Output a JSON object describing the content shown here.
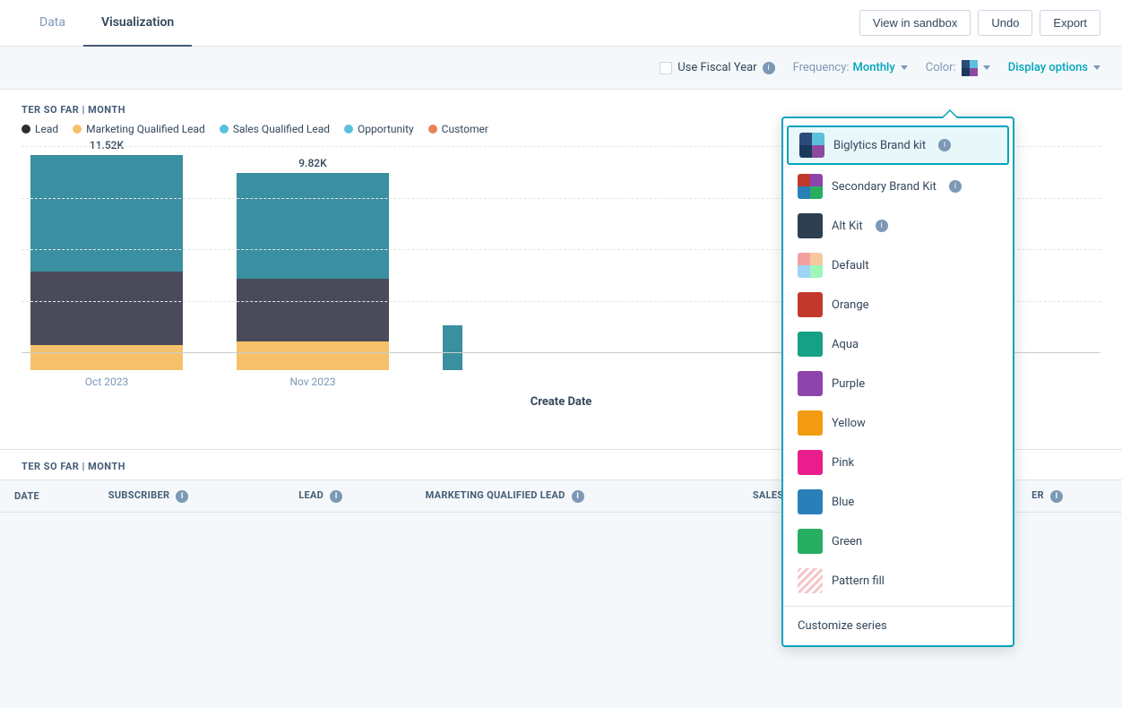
{
  "nav": {
    "tabs": [
      {
        "id": "data",
        "label": "Data",
        "active": false
      },
      {
        "id": "visualization",
        "label": "Visualization",
        "active": true
      }
    ],
    "actions": {
      "sandbox_label": "View in sandbox",
      "undo_label": "Undo",
      "export_label": "Export"
    }
  },
  "controls": {
    "fiscal_year_label": "Use Fiscal Year",
    "frequency_label": "Frequency:",
    "frequency_value": "Monthly",
    "color_label": "Color:",
    "display_options_label": "Display options"
  },
  "chart": {
    "section_label": "TER SO FAR | MONTH",
    "legend": [
      {
        "id": "lead",
        "label": "Lead",
        "color": "#000000"
      },
      {
        "id": "mql",
        "label": "Marketing Qualified Lead",
        "color": "#f5c26b"
      },
      {
        "id": "sql",
        "label": "Sales Qualified Lead",
        "color": "#f5c26b"
      },
      {
        "id": "opportunity",
        "label": "Opportunity",
        "color": "#5bc0de"
      },
      {
        "id": "customer",
        "label": "Customer",
        "color": "#e8845c"
      }
    ],
    "bars": [
      {
        "label": "Oct 2023",
        "total": "11.52K",
        "segments": [
          {
            "color": "#f5c26b",
            "height": 28
          },
          {
            "color": "#4a4a5a",
            "height": 80
          },
          {
            "color": "#3a8fa0",
            "height": 135
          }
        ]
      },
      {
        "label": "Nov 2023",
        "total": "9.82K",
        "segments": [
          {
            "color": "#f5c26b",
            "height": 32
          },
          {
            "color": "#4a4a5a",
            "height": 70
          },
          {
            "color": "#3a8fa0",
            "height": 120
          }
        ]
      }
    ],
    "x_axis_label": "Create Date"
  },
  "color_dropdown": {
    "items": [
      {
        "id": "biglytics",
        "label": "Biglytics Brand kit",
        "selected": true,
        "swatch_colors": [
          "#2d4a7a",
          "#5bc0de",
          "#1a3a5c",
          "#8b4a9e"
        ]
      },
      {
        "id": "secondary",
        "label": "Secondary Brand Kit",
        "selected": false,
        "swatch_colors": [
          "#c0392b",
          "#8e44ad",
          "#2980b9",
          "#27ae60"
        ]
      },
      {
        "id": "alt",
        "label": "Alt Kit",
        "selected": false,
        "swatch_colors": [
          "#2c3e50",
          "#2c3e50",
          "#2c3e50",
          "#2c3e50"
        ],
        "single_color": "#2c3e50"
      },
      {
        "id": "default",
        "label": "Default",
        "selected": false,
        "swatch_colors": [
          "#f5a0a0",
          "#f7c8a0",
          "#f5f0a0",
          "#a0d4f5"
        ]
      },
      {
        "id": "orange",
        "label": "Orange",
        "selected": false,
        "single_color": "#c0392b"
      },
      {
        "id": "aqua",
        "label": "Aqua",
        "selected": false,
        "single_color": "#16a085"
      },
      {
        "id": "purple",
        "label": "Purple",
        "selected": false,
        "single_color": "#8e44ad"
      },
      {
        "id": "yellow",
        "label": "Yellow",
        "selected": false,
        "single_color": "#f39c12"
      },
      {
        "id": "pink",
        "label": "Pink",
        "selected": false,
        "single_color": "#e91e8c"
      },
      {
        "id": "blue",
        "label": "Blue",
        "selected": false,
        "single_color": "#2980b9"
      },
      {
        "id": "green",
        "label": "Green",
        "selected": false,
        "single_color": "#27ae60"
      },
      {
        "id": "pattern",
        "label": "Pattern fill",
        "selected": false,
        "pattern": true
      }
    ],
    "customize_label": "Customize series"
  },
  "table": {
    "section_label": "TER SO FAR | MONTH",
    "columns": [
      {
        "id": "date",
        "label": "DATE"
      },
      {
        "id": "subscriber",
        "label": "SUBSCRIBER"
      },
      {
        "id": "lead",
        "label": "LEAD"
      },
      {
        "id": "mql",
        "label": "MARKETING QUALIFIED LEAD"
      },
      {
        "id": "sql",
        "label": "SALES QUALIFIED LEAD"
      },
      {
        "id": "er",
        "label": "ER"
      }
    ]
  }
}
